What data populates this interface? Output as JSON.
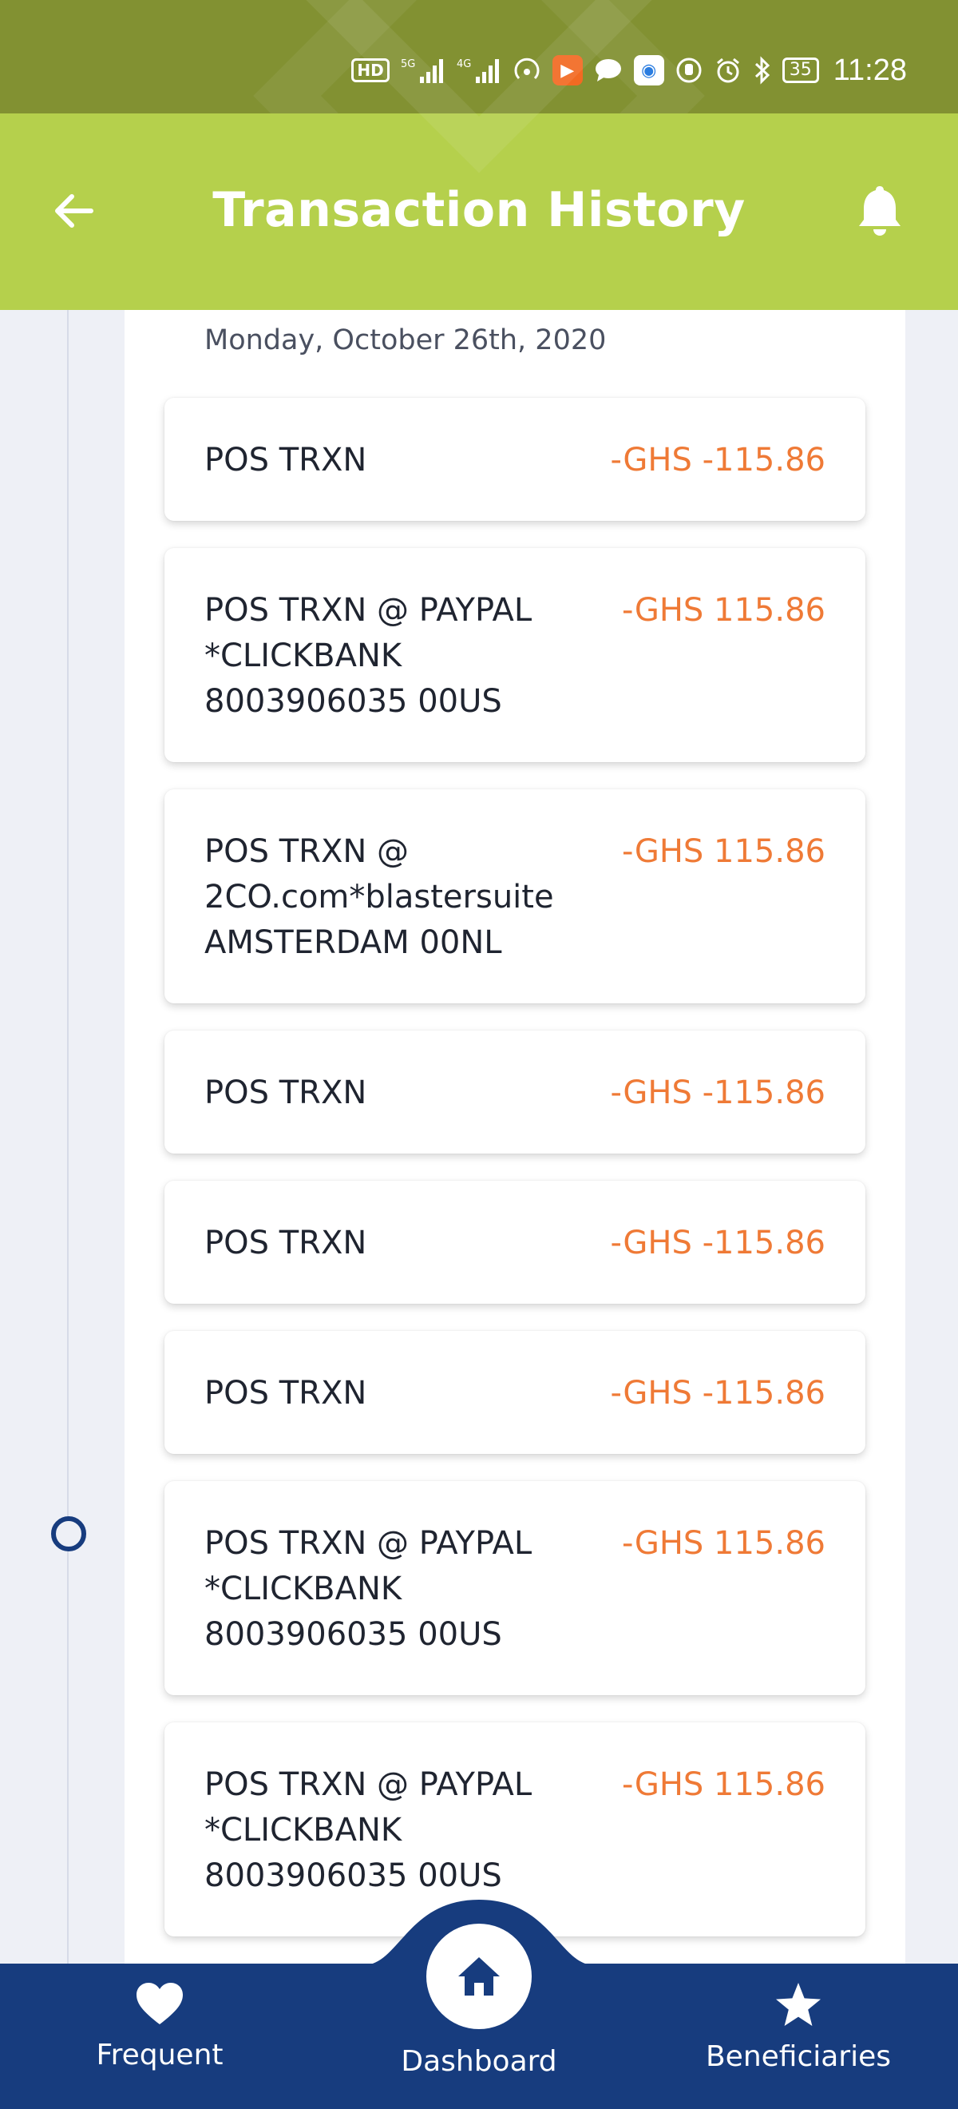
{
  "status_bar": {
    "network_1": "HD",
    "network_2": "5G",
    "network_3": "4G",
    "battery": "35",
    "time": "11:28"
  },
  "header": {
    "title": "Transaction History"
  },
  "date_label": "Monday, October 26th, 2020",
  "transactions": [
    {
      "description": "POS TRXN",
      "amount": "-GHS -115.86"
    },
    {
      "description": "POS TRXN @ PAYPAL\n*CLICKBANK\n8003906035   00US",
      "amount": "-GHS 115.86"
    },
    {
      "description": "POS TRXN @\n2CO.com*blastersuite\nAMSTERDAM   00NL",
      "amount": "-GHS 115.86"
    },
    {
      "description": "POS TRXN",
      "amount": "-GHS -115.86"
    },
    {
      "description": "POS TRXN",
      "amount": "-GHS -115.86"
    },
    {
      "description": "POS TRXN",
      "amount": "-GHS -115.86"
    },
    {
      "description": "POS TRXN @ PAYPAL\n*CLICKBANK\n8003906035   00US",
      "amount": "-GHS 115.86"
    },
    {
      "description": "POS TRXN @ PAYPAL\n*CLICKBANK\n8003906035   00US",
      "amount": "-GHS 115.86"
    }
  ],
  "bottom_nav": {
    "frequent": "Frequent",
    "dashboard": "Dashboard",
    "beneficiaries": "Beneficiaries"
  },
  "colors": {
    "header_green": "#b5d04c",
    "statusbar_green": "#829132",
    "nav_blue": "#173c7e",
    "amount_orange": "#ef7a36"
  }
}
